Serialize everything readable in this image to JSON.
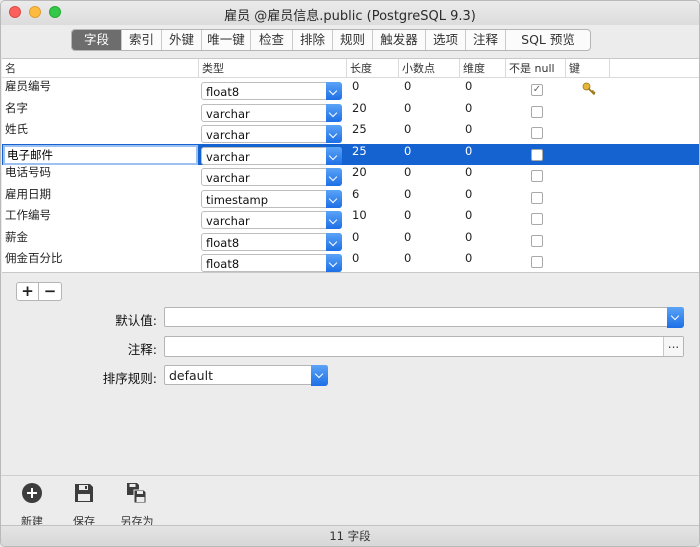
{
  "window": {
    "title": "雇员 @雇员信息.public (PostgreSQL 9.3)"
  },
  "tabs": [
    {
      "label": "字段",
      "active": true
    },
    {
      "label": "索引"
    },
    {
      "label": "外键"
    },
    {
      "label": "唯一键"
    },
    {
      "label": "检查"
    },
    {
      "label": "排除"
    },
    {
      "label": "规则"
    },
    {
      "label": "触发器"
    },
    {
      "label": "选项"
    },
    {
      "label": "注释"
    },
    {
      "label": "SQL 预览"
    }
  ],
  "grid": {
    "columns": [
      "名",
      "类型",
      "长度",
      "小数点",
      "维度",
      "不是 null",
      "键"
    ],
    "rows": [
      {
        "name": "雇员编号",
        "type": "float8",
        "length": "0",
        "decimal": "0",
        "dimension": "0",
        "not_null": true,
        "key": true
      },
      {
        "name": "名字",
        "type": "varchar",
        "length": "20",
        "decimal": "0",
        "dimension": "0",
        "not_null": false,
        "key": false
      },
      {
        "name": "姓氏",
        "type": "varchar",
        "length": "25",
        "decimal": "0",
        "dimension": "0",
        "not_null": false,
        "key": false
      },
      {
        "name": "电子邮件",
        "type": "varchar",
        "length": "25",
        "decimal": "0",
        "dimension": "0",
        "not_null": false,
        "key": false,
        "selected": true
      },
      {
        "name": "电话号码",
        "type": "varchar",
        "length": "20",
        "decimal": "0",
        "dimension": "0",
        "not_null": false,
        "key": false
      },
      {
        "name": "雇用日期",
        "type": "timestamp",
        "length": "6",
        "decimal": "0",
        "dimension": "0",
        "not_null": false,
        "key": false
      },
      {
        "name": "工作编号",
        "type": "varchar",
        "length": "10",
        "decimal": "0",
        "dimension": "0",
        "not_null": false,
        "key": false
      },
      {
        "name": "薪金",
        "type": "float8",
        "length": "0",
        "decimal": "0",
        "dimension": "0",
        "not_null": false,
        "key": false
      },
      {
        "name": "佣金百分比",
        "type": "float8",
        "length": "0",
        "decimal": "0",
        "dimension": "0",
        "not_null": false,
        "key": false
      }
    ]
  },
  "field_buttons": {
    "add": "+",
    "remove": "−"
  },
  "form": {
    "default_label": "默认值:",
    "default_value": "",
    "comment_label": "注释:",
    "comment_value": "",
    "comment_more": "...",
    "collation_label": "排序规则:",
    "collation_value": "default"
  },
  "toolbar": {
    "new_label": "新建",
    "save_label": "保存",
    "save_as_label": "另存为"
  },
  "status": {
    "text": "11 字段"
  },
  "colors": {
    "selection": "#1563d1",
    "accent": "#1d6fe6"
  }
}
